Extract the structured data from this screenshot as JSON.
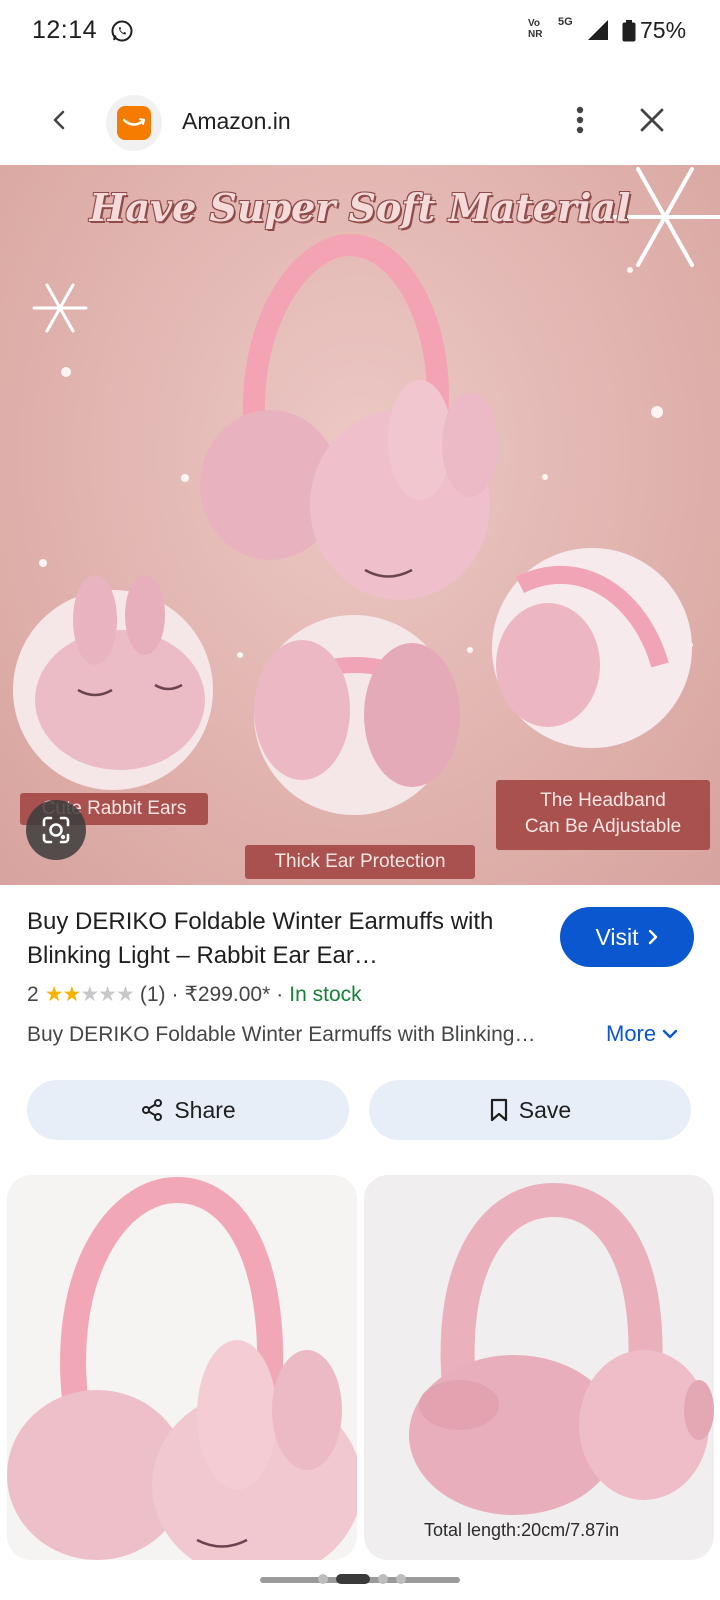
{
  "status_bar": {
    "time": "12:14",
    "volte_line1": "Vo",
    "volte_line2": "NR",
    "network": "5G",
    "battery": "75%"
  },
  "header": {
    "site_name": "Amazon.in"
  },
  "hero": {
    "title": "Have Super Soft Material",
    "label_rabbit": "Cute Rabbit Ears",
    "label_headband_line1": "The Headband",
    "label_headband_line2": "Can Be Adjustable",
    "label_thick": "Thick Ear Protection"
  },
  "product": {
    "title": "Buy DERIKO Foldable Winter Earmuffs with Blinking Light – Rabbit Ear Ear…",
    "rating_value": "2",
    "rating_stars": 2,
    "rating_count": "(1)",
    "separator": "·",
    "price": "₹299.00*",
    "availability": "In stock",
    "description": "Buy DERIKO Foldable Winter Earmuffs with Blinking…",
    "more_label": "More",
    "visit_label": "Visit"
  },
  "actions": {
    "share_label": "Share",
    "save_label": "Save"
  },
  "related": {
    "thumb2_caption": "Total length:20cm/7.87in"
  },
  "colors": {
    "accent": "#0b57d0",
    "in_stock": "#188038",
    "star": "#f6b400",
    "hero_bg": "#e0b2ad",
    "label_bg": "#a8514f"
  }
}
